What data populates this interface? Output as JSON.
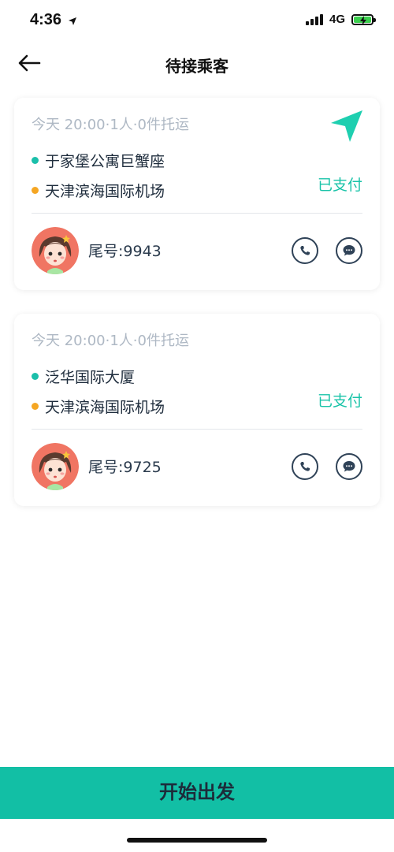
{
  "status_bar": {
    "time": "4:36",
    "network": "4G",
    "icons": [
      "location-arrow-icon",
      "signal-icon",
      "battery-charging-icon"
    ]
  },
  "nav": {
    "title": "待接乘客",
    "back_icon": "back-arrow-icon"
  },
  "passengers": [
    {
      "meta": "今天 20:00·1人·0件托运",
      "pickup": "于家堡公寓巨蟹座",
      "dropoff": "天津滨海国际机场",
      "status": "已支付",
      "tail": "尾号:9943",
      "show_nav_icon": true
    },
    {
      "meta": "今天 20:00·1人·0件托运",
      "pickup": "泛华国际大厦",
      "dropoff": "天津滨海国际机场",
      "status": "已支付",
      "tail": "尾号:9725",
      "show_nav_icon": false
    }
  ],
  "footer": {
    "start_label": "开始出发"
  },
  "colors": {
    "accent": "#12bfa5",
    "paid_text": "#19c3a8",
    "pickup_dot": "#1bbfaa",
    "dropoff_dot": "#f5a623"
  }
}
